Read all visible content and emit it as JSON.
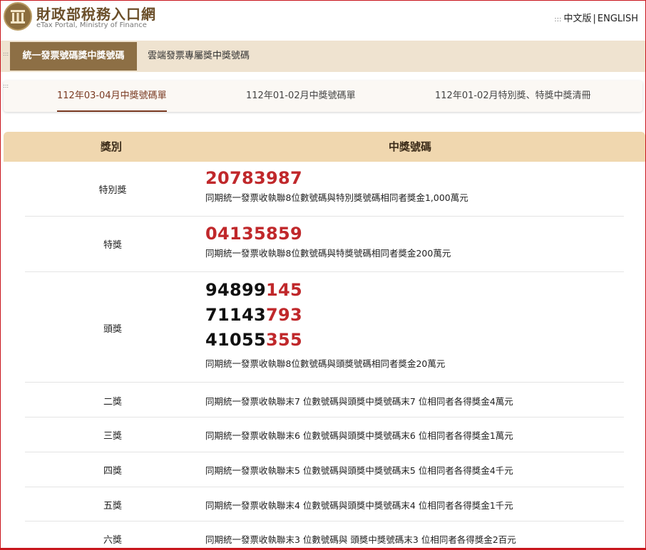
{
  "header": {
    "site_title": "財政部稅務入口網",
    "site_subtitle": "eTax Portal, Ministry of Finance",
    "lang_zh": "中文版",
    "lang_sep": "|",
    "lang_en": "ENGLISH"
  },
  "main_tabs": [
    {
      "label": "統一發票號碼獎中獎號碼",
      "active": true
    },
    {
      "label": "雲端發票專屬獎中獎號碼",
      "active": false
    }
  ],
  "sub_tabs": [
    {
      "label": "112年03-04月中獎號碼單",
      "active": true
    },
    {
      "label": "112年01-02月中獎號碼單",
      "active": false
    },
    {
      "label": "112年01-02月特別獎、特獎中獎清冊",
      "active": false
    }
  ],
  "table": {
    "col_prize": "獎別",
    "col_numbers": "中獎號碼",
    "rows": [
      {
        "prize": "特別獎",
        "numbers": [
          {
            "prefix": "",
            "highlight": "20783987"
          }
        ],
        "desc": "同期統一發票收執聯8位數號碼與特別獎號碼相同者獎金1,000萬元"
      },
      {
        "prize": "特獎",
        "numbers": [
          {
            "prefix": "",
            "highlight": "04135859"
          }
        ],
        "desc": "同期統一發票收執聯8位數號碼與特獎號碼相同者獎金200萬元"
      },
      {
        "prize": "頭獎",
        "numbers": [
          {
            "prefix": "94899",
            "highlight": "145"
          },
          {
            "prefix": "71143",
            "highlight": "793"
          },
          {
            "prefix": "41055",
            "highlight": "355"
          }
        ],
        "desc": "同期統一發票收執聯8位數號碼與頭獎號碼相同者獎金20萬元"
      },
      {
        "prize": "二獎",
        "desc": "同期統一發票收執聯末7 位數號碼與頭獎中獎號碼末7 位相同者各得獎金4萬元"
      },
      {
        "prize": "三獎",
        "desc": "同期統一發票收執聯末6 位數號碼與頭獎中獎號碼末6 位相同者各得獎金1萬元"
      },
      {
        "prize": "四獎",
        "desc": "同期統一發票收執聯末5 位數號碼與頭獎中獎號碼末5 位相同者各得獎金4千元"
      },
      {
        "prize": "五獎",
        "desc": "同期統一發票收執聯末4 位數號碼與頭獎中獎號碼末4 位相同者各得獎金1千元"
      },
      {
        "prize": "六獎",
        "desc": "同期統一發票收執聯末3 位數號碼與 頭獎中獎號碼末3 位相同者各得獎金2百元"
      }
    ]
  }
}
